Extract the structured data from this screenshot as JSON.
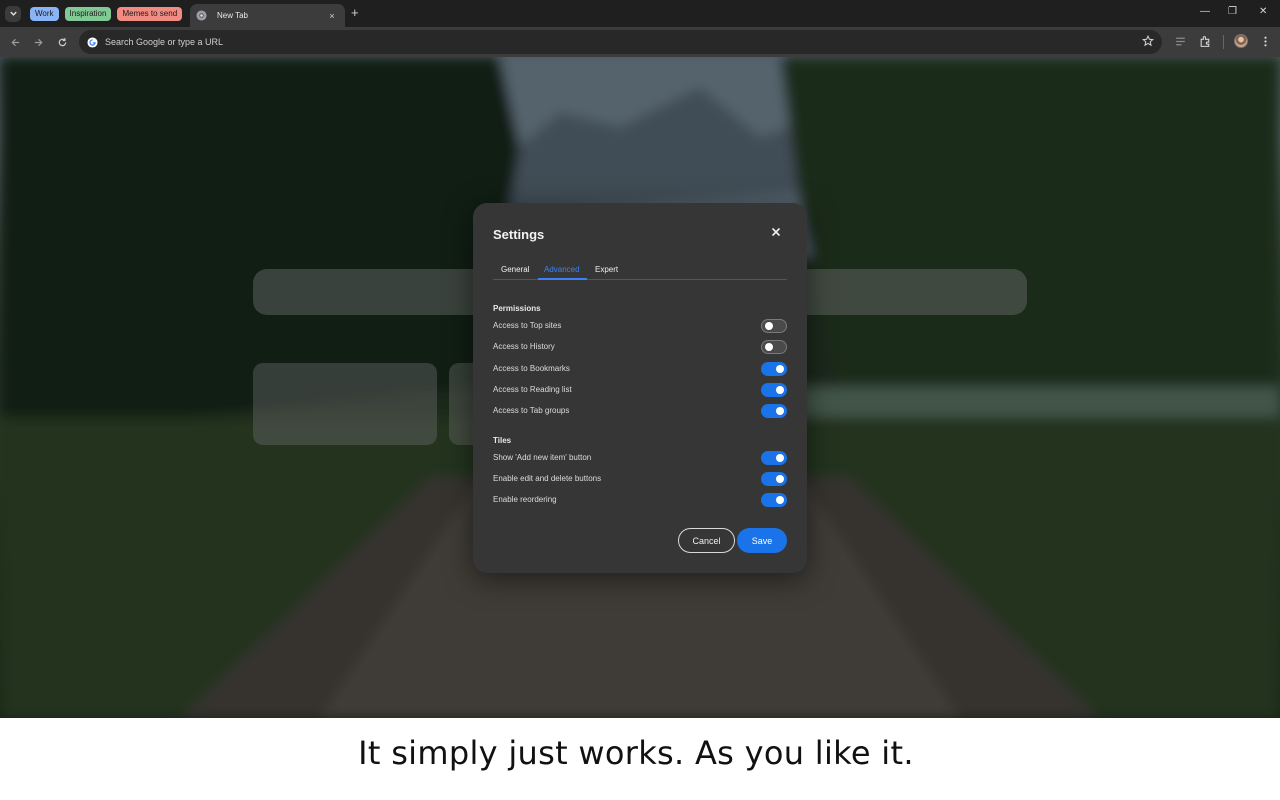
{
  "browser": {
    "tab_groups": [
      {
        "label": "Work",
        "color": "#8ab4f8"
      },
      {
        "label": "Inspiration",
        "color": "#81c995"
      },
      {
        "label": "Memes to send",
        "color": "#f28b82"
      }
    ],
    "active_tab": {
      "title": "New Tab",
      "close": "×"
    },
    "new_tab": "+",
    "window_controls": {
      "minimize": "—",
      "restore": "❐",
      "close": "✕"
    },
    "omnibox": {
      "placeholder": "Search Google or type a URL"
    }
  },
  "dialog": {
    "title": "Settings",
    "tabs": [
      {
        "label": "General",
        "active": false
      },
      {
        "label": "Advanced",
        "active": true
      },
      {
        "label": "Expert",
        "active": false
      }
    ],
    "sections": {
      "permissions": {
        "title": "Permissions",
        "items": [
          {
            "label": "Access to Top sites",
            "on": false
          },
          {
            "label": "Access to History",
            "on": false
          },
          {
            "label": "Access to Bookmarks",
            "on": true
          },
          {
            "label": "Access to Reading list",
            "on": true
          },
          {
            "label": "Access to Tab groups",
            "on": true
          }
        ]
      },
      "tiles": {
        "title": "Tiles",
        "items": [
          {
            "label": "Show 'Add new item' button",
            "on": true
          },
          {
            "label": "Enable edit and delete buttons",
            "on": true
          },
          {
            "label": "Enable reordering",
            "on": true
          }
        ]
      }
    },
    "buttons": {
      "cancel": "Cancel",
      "save": "Save"
    }
  },
  "caption": "It simply just works. As you like it.",
  "colors": {
    "accent": "#1a73e8",
    "dialog_bg": "#363636"
  }
}
